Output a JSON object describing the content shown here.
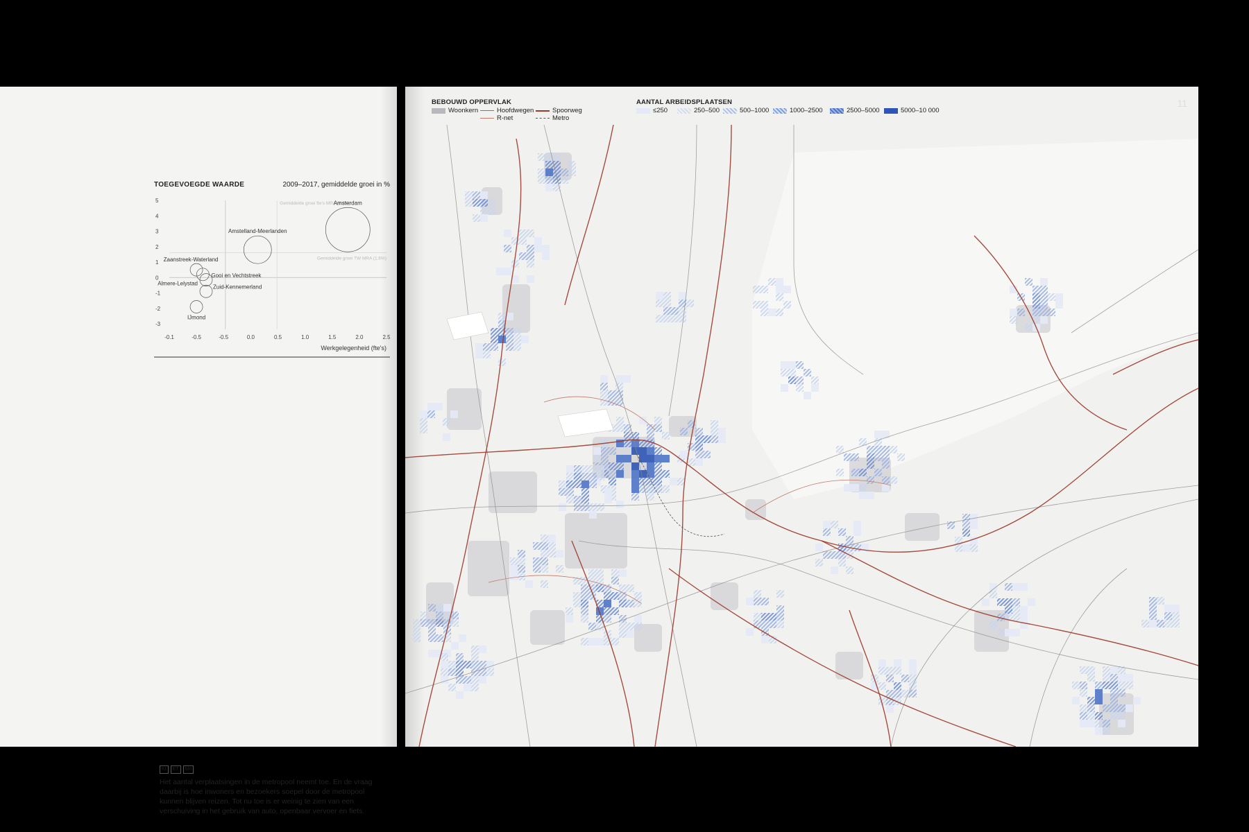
{
  "left_page": {
    "chart": {
      "title": "TOEGEVOEGDE WAARDE",
      "subtitle": "2009–2017, gemiddelde groei in %",
      "xlabel": "Werkgelegenheid (fte's)",
      "x_ticks": [
        "-0.1",
        "-0.5",
        "-0.5",
        "0.0",
        "0.5",
        "1.0",
        "1.5",
        "2.0",
        "2.5"
      ],
      "y_ticks": [
        "5",
        "4",
        "3",
        "2",
        "1",
        "0",
        "-1",
        "-2",
        "-3"
      ],
      "ref_label_1": "Gemiddelde groei fte's MRA (0.8%)",
      "ref_label_2": "Gemiddelde groei TW MRA (1.6%)"
    },
    "chart_data": {
      "type": "scatter",
      "title": "TOEGEVOEGDE WAARDE",
      "subtitle": "2009–2017, gemiddelde groei in %",
      "xlabel": "Werkgelegenheid (fte's)",
      "ylabel": "",
      "xlim": [
        -1.0,
        2.5
      ],
      "ylim": [
        -3,
        5
      ],
      "points": [
        {
          "label": "Amsterdam",
          "x": 1.9,
          "y": 3.1
        },
        {
          "label": "Amstelland-Meerlanden",
          "x": 0.5,
          "y": 1.8
        },
        {
          "label": "Zaanstreek-Waterland",
          "x": -0.5,
          "y": 0.7
        },
        {
          "label": "Gooi en Vechtstreek",
          "x": -0.35,
          "y": 0.4
        },
        {
          "label": "Almere-Lelystad",
          "x": -0.25,
          "y": -0.1
        },
        {
          "label": "Zuid-Kennemerland",
          "x": -0.4,
          "y": -1.4
        },
        {
          "label": "IJmond",
          "x": -0.4,
          "y": -1.4
        }
      ]
    },
    "tags": [
      "KI",
      "ET",
      "Mo"
    ],
    "body_text": "Het aantal verplaatsingen in de metropool neemt toe. En de vraag daarbij is hoe inwoners en bezoekers soepel door de metropool kunnen blijven reizen. Tot nu toe is er weinig te zien van een verschuiving in het gebruik van auto, openbaar vervoer en fiets."
  },
  "right_page": {
    "page_number": "11",
    "legend": {
      "built_title": "BEBOUWD OPPERVLAK",
      "woonkern": "Woonkern",
      "hoofdwegen": "Hoofdwegen",
      "rnet": "R-net",
      "spoorweg": "Spoorweg",
      "metro": "Metro",
      "jobs_title": "AANTAL ARBEIDSPLAATSEN",
      "classes": [
        "≤250",
        "250–500",
        "500–1000",
        "1000–2500",
        "2500–5000",
        "5000–10 000"
      ]
    },
    "colors": {
      "built": "#cfcfd3",
      "rail": "#9b3a2b",
      "road": "#8a8a8a",
      "jobs_light": "#c9d6ef",
      "jobs_mid": "#7f9fda",
      "jobs_dark": "#2e55b5"
    }
  }
}
